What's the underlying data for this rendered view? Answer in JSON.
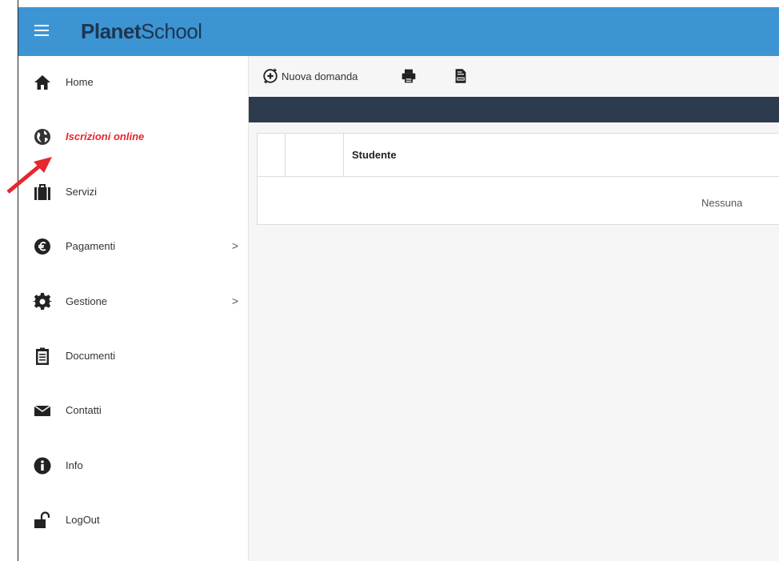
{
  "header": {
    "app_name_bold": "Planet",
    "app_name_light": "School",
    "bg_color": "#3d94d3"
  },
  "sidebar": {
    "items": [
      {
        "label": "Home",
        "icon": "home-icon"
      },
      {
        "label": "Iscrizioni online",
        "icon": "globe-icon",
        "active": true
      },
      {
        "label": "Servizi",
        "icon": "briefcase-icon"
      },
      {
        "label": "Pagamenti",
        "icon": "euro-icon",
        "chevron": ">"
      },
      {
        "label": "Gestione",
        "icon": "gear-icon",
        "chevron": ">"
      },
      {
        "label": "Documenti",
        "icon": "clipboard-icon"
      },
      {
        "label": "Contatti",
        "icon": "envelope-icon"
      },
      {
        "label": "Info",
        "icon": "info-icon"
      },
      {
        "label": "LogOut",
        "icon": "unlock-icon"
      }
    ],
    "active_color": "#e8262d"
  },
  "toolbar": {
    "new_label": "Nuova domanda",
    "new_icon": "refresh-plus-icon",
    "print_icon": "printer-icon",
    "export_icon": "document-export-icon"
  },
  "table": {
    "header_studente": "Studente",
    "empty_message": "Nessuna"
  },
  "annotation": {
    "arrow_color": "#e8262d"
  }
}
